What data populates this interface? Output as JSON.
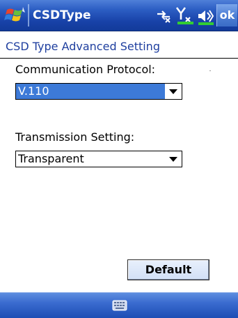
{
  "titlebar": {
    "app_title": "CSDType",
    "ok_label": "ok",
    "icons": [
      "windows-start-icon",
      "connectivity-icon",
      "signal-strength-icon",
      "volume-icon"
    ]
  },
  "page": {
    "heading": "CSD Type Advanced Setting"
  },
  "form": {
    "protocol_label": "Communication Protocol:",
    "protocol_value": "V.110",
    "transmission_label": "Transmission Setting:",
    "transmission_value": "Transparent"
  },
  "buttons": {
    "default_label": "Default"
  },
  "menubar": {
    "icons": [
      "keyboard-icon"
    ]
  },
  "colors": {
    "titlebar_blue": "#1842a8",
    "heading_blue": "#1f3f9f",
    "selection_blue": "#3d7ad8",
    "menubar_blue": "#3a6bcf"
  }
}
